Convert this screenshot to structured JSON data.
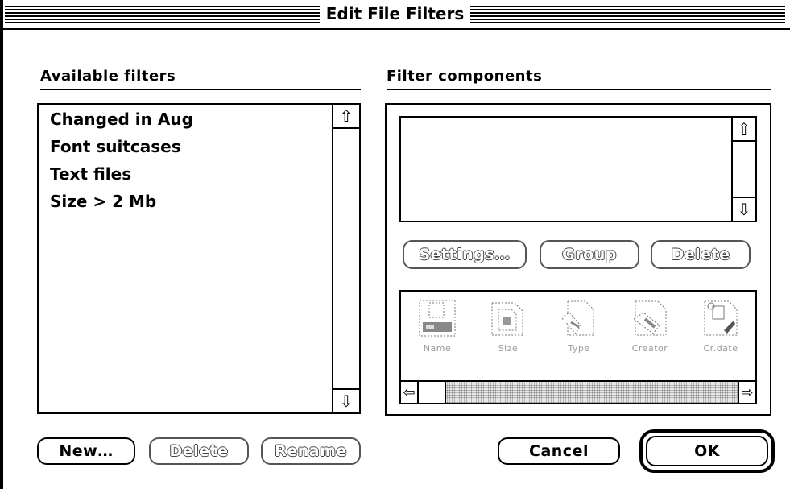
{
  "window": {
    "title": "Edit File Filters"
  },
  "available": {
    "label": "Available filters",
    "items": [
      "Changed in Aug",
      "Font suitcases",
      "Text files",
      "Size > 2 Mb"
    ],
    "scroll_up": "⇧",
    "scroll_down": "⇩"
  },
  "components": {
    "label": "Filter components",
    "scroll_up": "⇧",
    "scroll_down": "⇩",
    "buttons": {
      "settings": "Settings…",
      "group": "Group",
      "delete": "Delete"
    },
    "icons": [
      {
        "label": "Name",
        "icon": "name-icon"
      },
      {
        "label": "Size",
        "icon": "size-icon"
      },
      {
        "label": "Type",
        "icon": "type-icon"
      },
      {
        "label": "Creator",
        "icon": "creator-icon"
      },
      {
        "label": "Cr.date",
        "icon": "creation-date-icon"
      }
    ],
    "hscroll_left": "⇦",
    "hscroll_right": "⇨"
  },
  "bottom": {
    "new": "New…",
    "delete": "Delete",
    "rename": "Rename",
    "cancel": "Cancel",
    "ok": "OK"
  }
}
